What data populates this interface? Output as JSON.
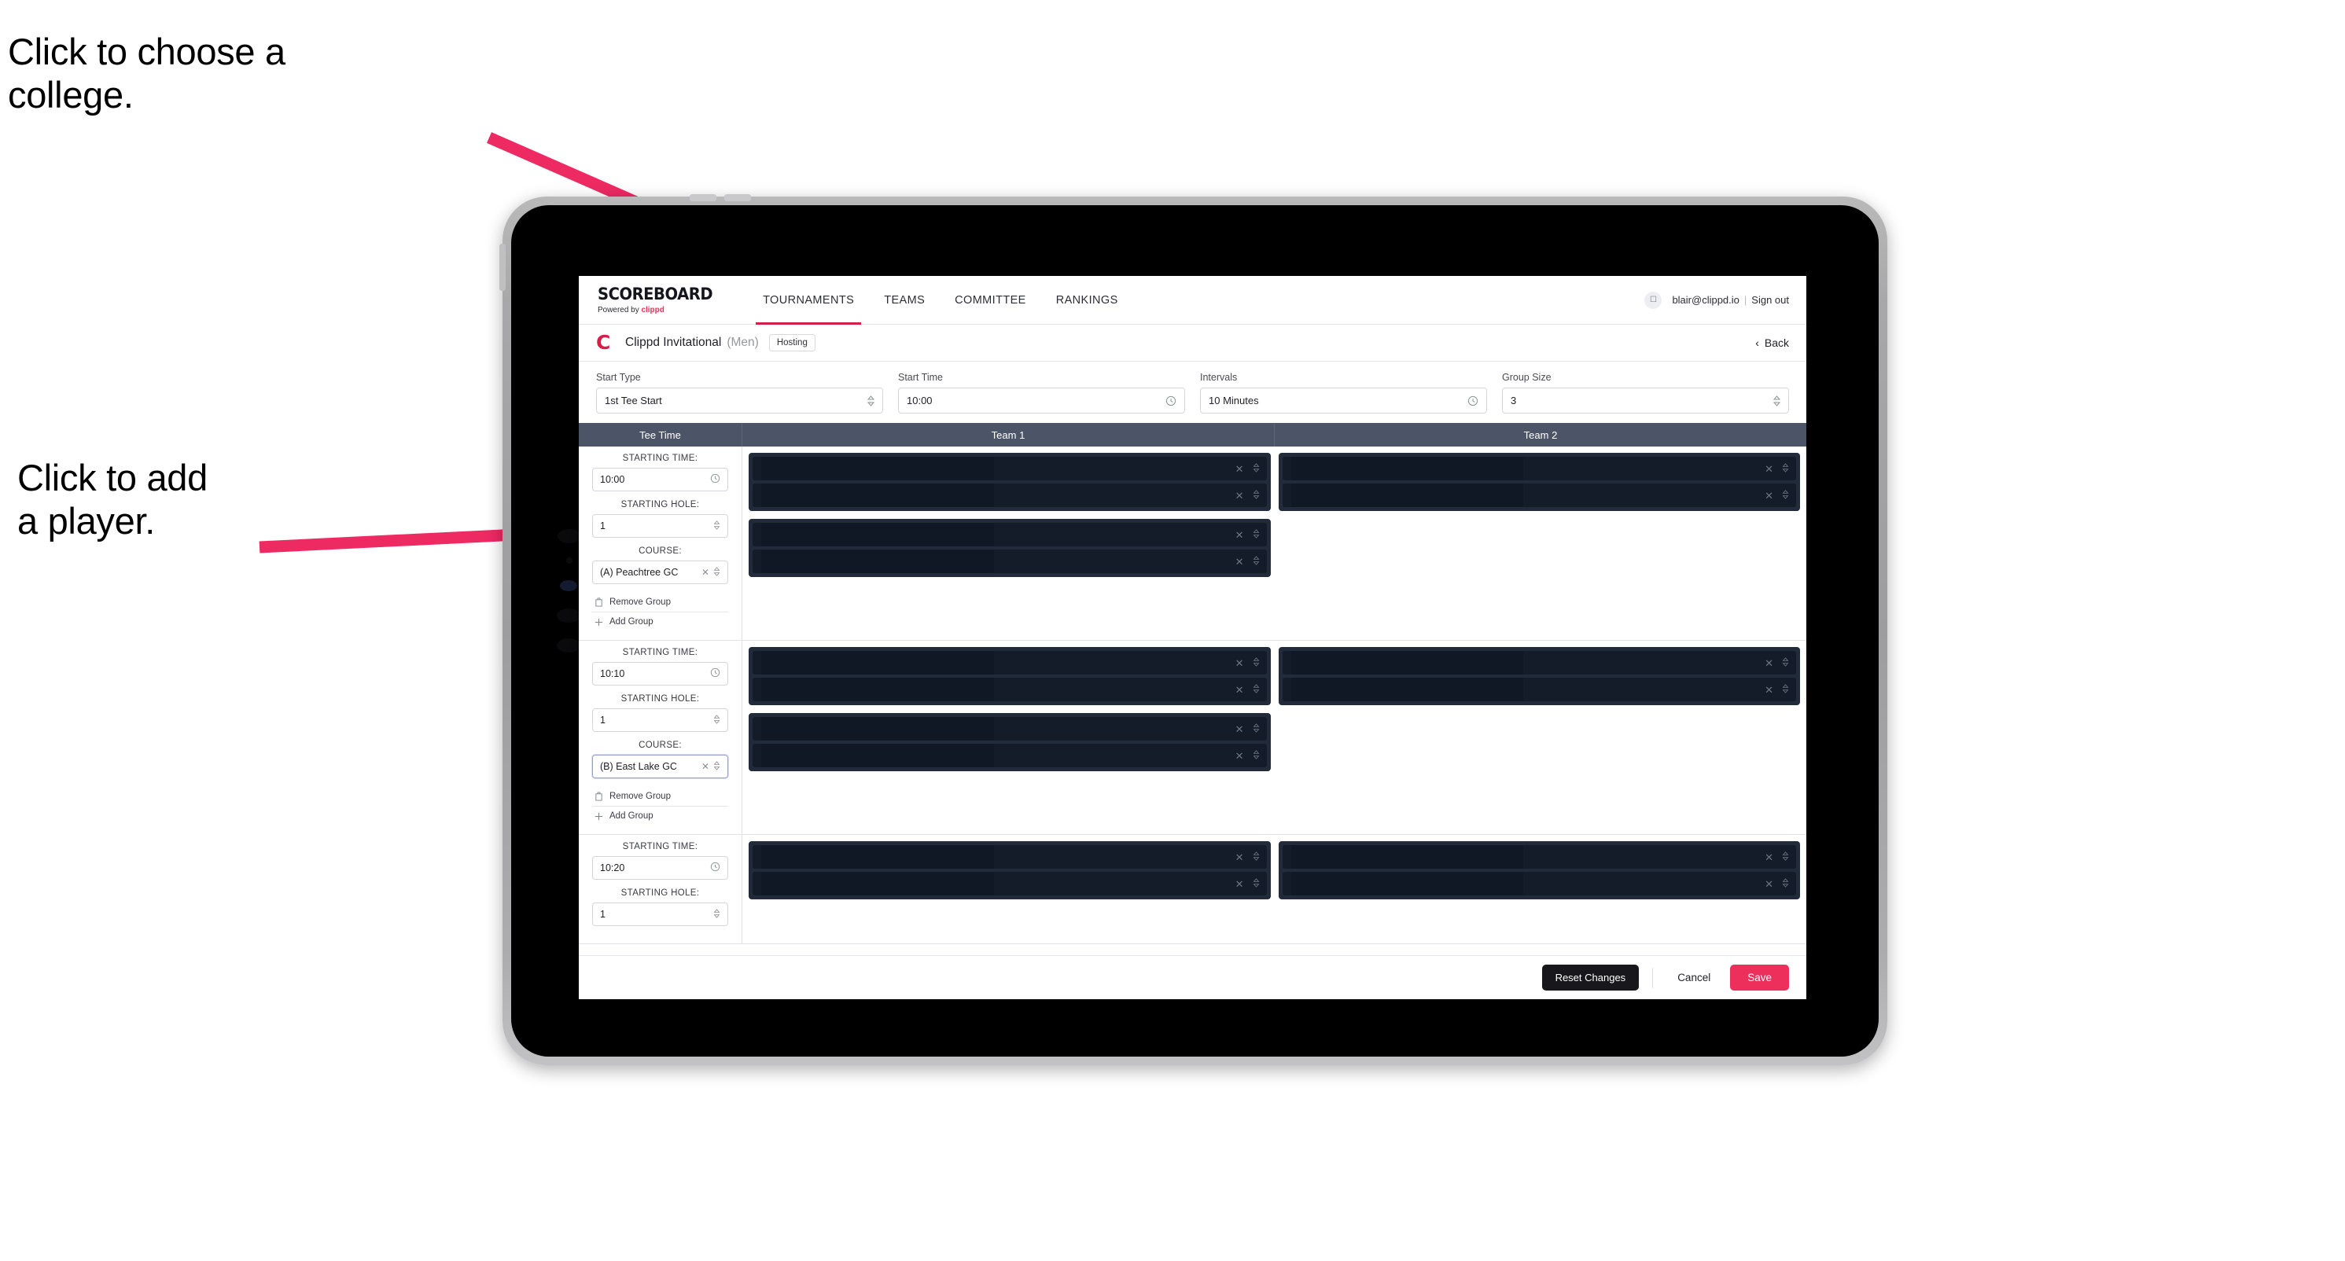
{
  "annotations": [
    {
      "id": "annot-college",
      "text": "Click to choose a\ncollege."
    },
    {
      "id": "annot-player",
      "text": "Click to add\na player."
    }
  ],
  "colors": {
    "accent_pink": "#ec2f5b",
    "nav_active_underline": "#d61f47",
    "table_header_bg": "#4c5567",
    "panel_dark": "#222b3a",
    "row_dark": "#141c2a",
    "arrow_pink": "#ee2a63"
  },
  "topnav": {
    "brand_wordmark": "SCOREBOARD",
    "brand_powered_prefix": "Powered by ",
    "brand_powered_name": "clippd",
    "tabs": [
      {
        "label": "TOURNAMENTS",
        "active": true
      },
      {
        "label": "TEAMS",
        "active": false
      },
      {
        "label": "COMMITTEE",
        "active": false
      },
      {
        "label": "RANKINGS",
        "active": false
      }
    ],
    "avatar_icon": "user-avatar-icon",
    "account_email": "blair@clippd.io",
    "separator": "|",
    "sign_out_label": "Sign out"
  },
  "tournament_bar": {
    "logo_letter": "C",
    "name": "Clippd Invitational",
    "gender": "(Men)",
    "badge": "Hosting",
    "back_label": "Back",
    "back_icon": "chevron-left-icon"
  },
  "settings": {
    "fields": [
      {
        "label": "Start Type",
        "value": "1st Tee Start",
        "icon": "chevron-updown-icon"
      },
      {
        "label": "Start Time",
        "value": "10:00",
        "icon": "clock-icon"
      },
      {
        "label": "Intervals",
        "value": "10 Minutes",
        "icon": "clock-icon"
      },
      {
        "label": "Group Size",
        "value": "3",
        "icon": "chevron-updown-icon"
      }
    ]
  },
  "table": {
    "headers": [
      "Tee Time",
      "Team 1",
      "Team 2"
    ],
    "labels": {
      "starting_time": "STARTING TIME:",
      "starting_hole": "STARTING HOLE:",
      "course": "COURSE:",
      "remove_group": "Remove Group",
      "add_group": "Add Group",
      "remove_icon": "trash-icon",
      "add_icon": "plus-icon",
      "clear_icon": "close-x-icon",
      "stepper_icon": "chevron-updown-icon",
      "clock_icon": "clock-icon"
    },
    "groups": [
      {
        "starting_time": "10:00",
        "starting_hole": "1",
        "course": "(A) Peachtree GC",
        "course_focused": false,
        "team1": [
          {
            "rows": 2
          },
          {
            "rows": 2
          }
        ],
        "team2": [
          {
            "rows": 2
          }
        ]
      },
      {
        "starting_time": "10:10",
        "starting_hole": "1",
        "course": "(B) East Lake GC",
        "course_focused": true,
        "team1": [
          {
            "rows": 2
          },
          {
            "rows": 2
          }
        ],
        "team2": [
          {
            "rows": 2
          }
        ]
      },
      {
        "starting_time": "10:20",
        "starting_hole": "1",
        "course": "",
        "course_focused": false,
        "team1": [
          {
            "rows": 2
          }
        ],
        "team2": [
          {
            "rows": 2
          }
        ]
      }
    ]
  },
  "footer": {
    "reset_label": "Reset Changes",
    "cancel_label": "Cancel",
    "save_label": "Save"
  }
}
